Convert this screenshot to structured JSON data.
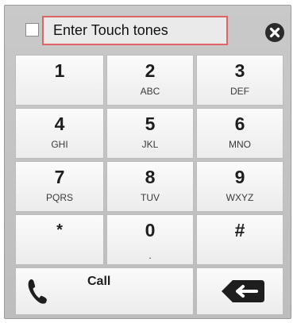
{
  "header": {
    "tone_input_value": "Enter Touch tones",
    "checkbox_checked": false
  },
  "keypad": {
    "keys": [
      {
        "digit": "1",
        "letters": ""
      },
      {
        "digit": "2",
        "letters": "ABC"
      },
      {
        "digit": "3",
        "letters": "DEF"
      },
      {
        "digit": "4",
        "letters": "GHI"
      },
      {
        "digit": "5",
        "letters": "JKL"
      },
      {
        "digit": "6",
        "letters": "MNO"
      },
      {
        "digit": "7",
        "letters": "PQRS"
      },
      {
        "digit": "8",
        "letters": "TUV"
      },
      {
        "digit": "9",
        "letters": "WXYZ"
      },
      {
        "digit": "*",
        "letters": ""
      },
      {
        "digit": "0",
        "letters": "."
      },
      {
        "digit": "#",
        "letters": ""
      }
    ]
  },
  "actions": {
    "call_label": "Call"
  },
  "icons": {
    "close": "close-icon",
    "phone": "phone-icon",
    "backspace": "backspace-icon"
  },
  "colors": {
    "panel_background": "#c4c4c4",
    "input_border_highlight": "#e06464",
    "icon_dark": "#2b2b2b"
  }
}
